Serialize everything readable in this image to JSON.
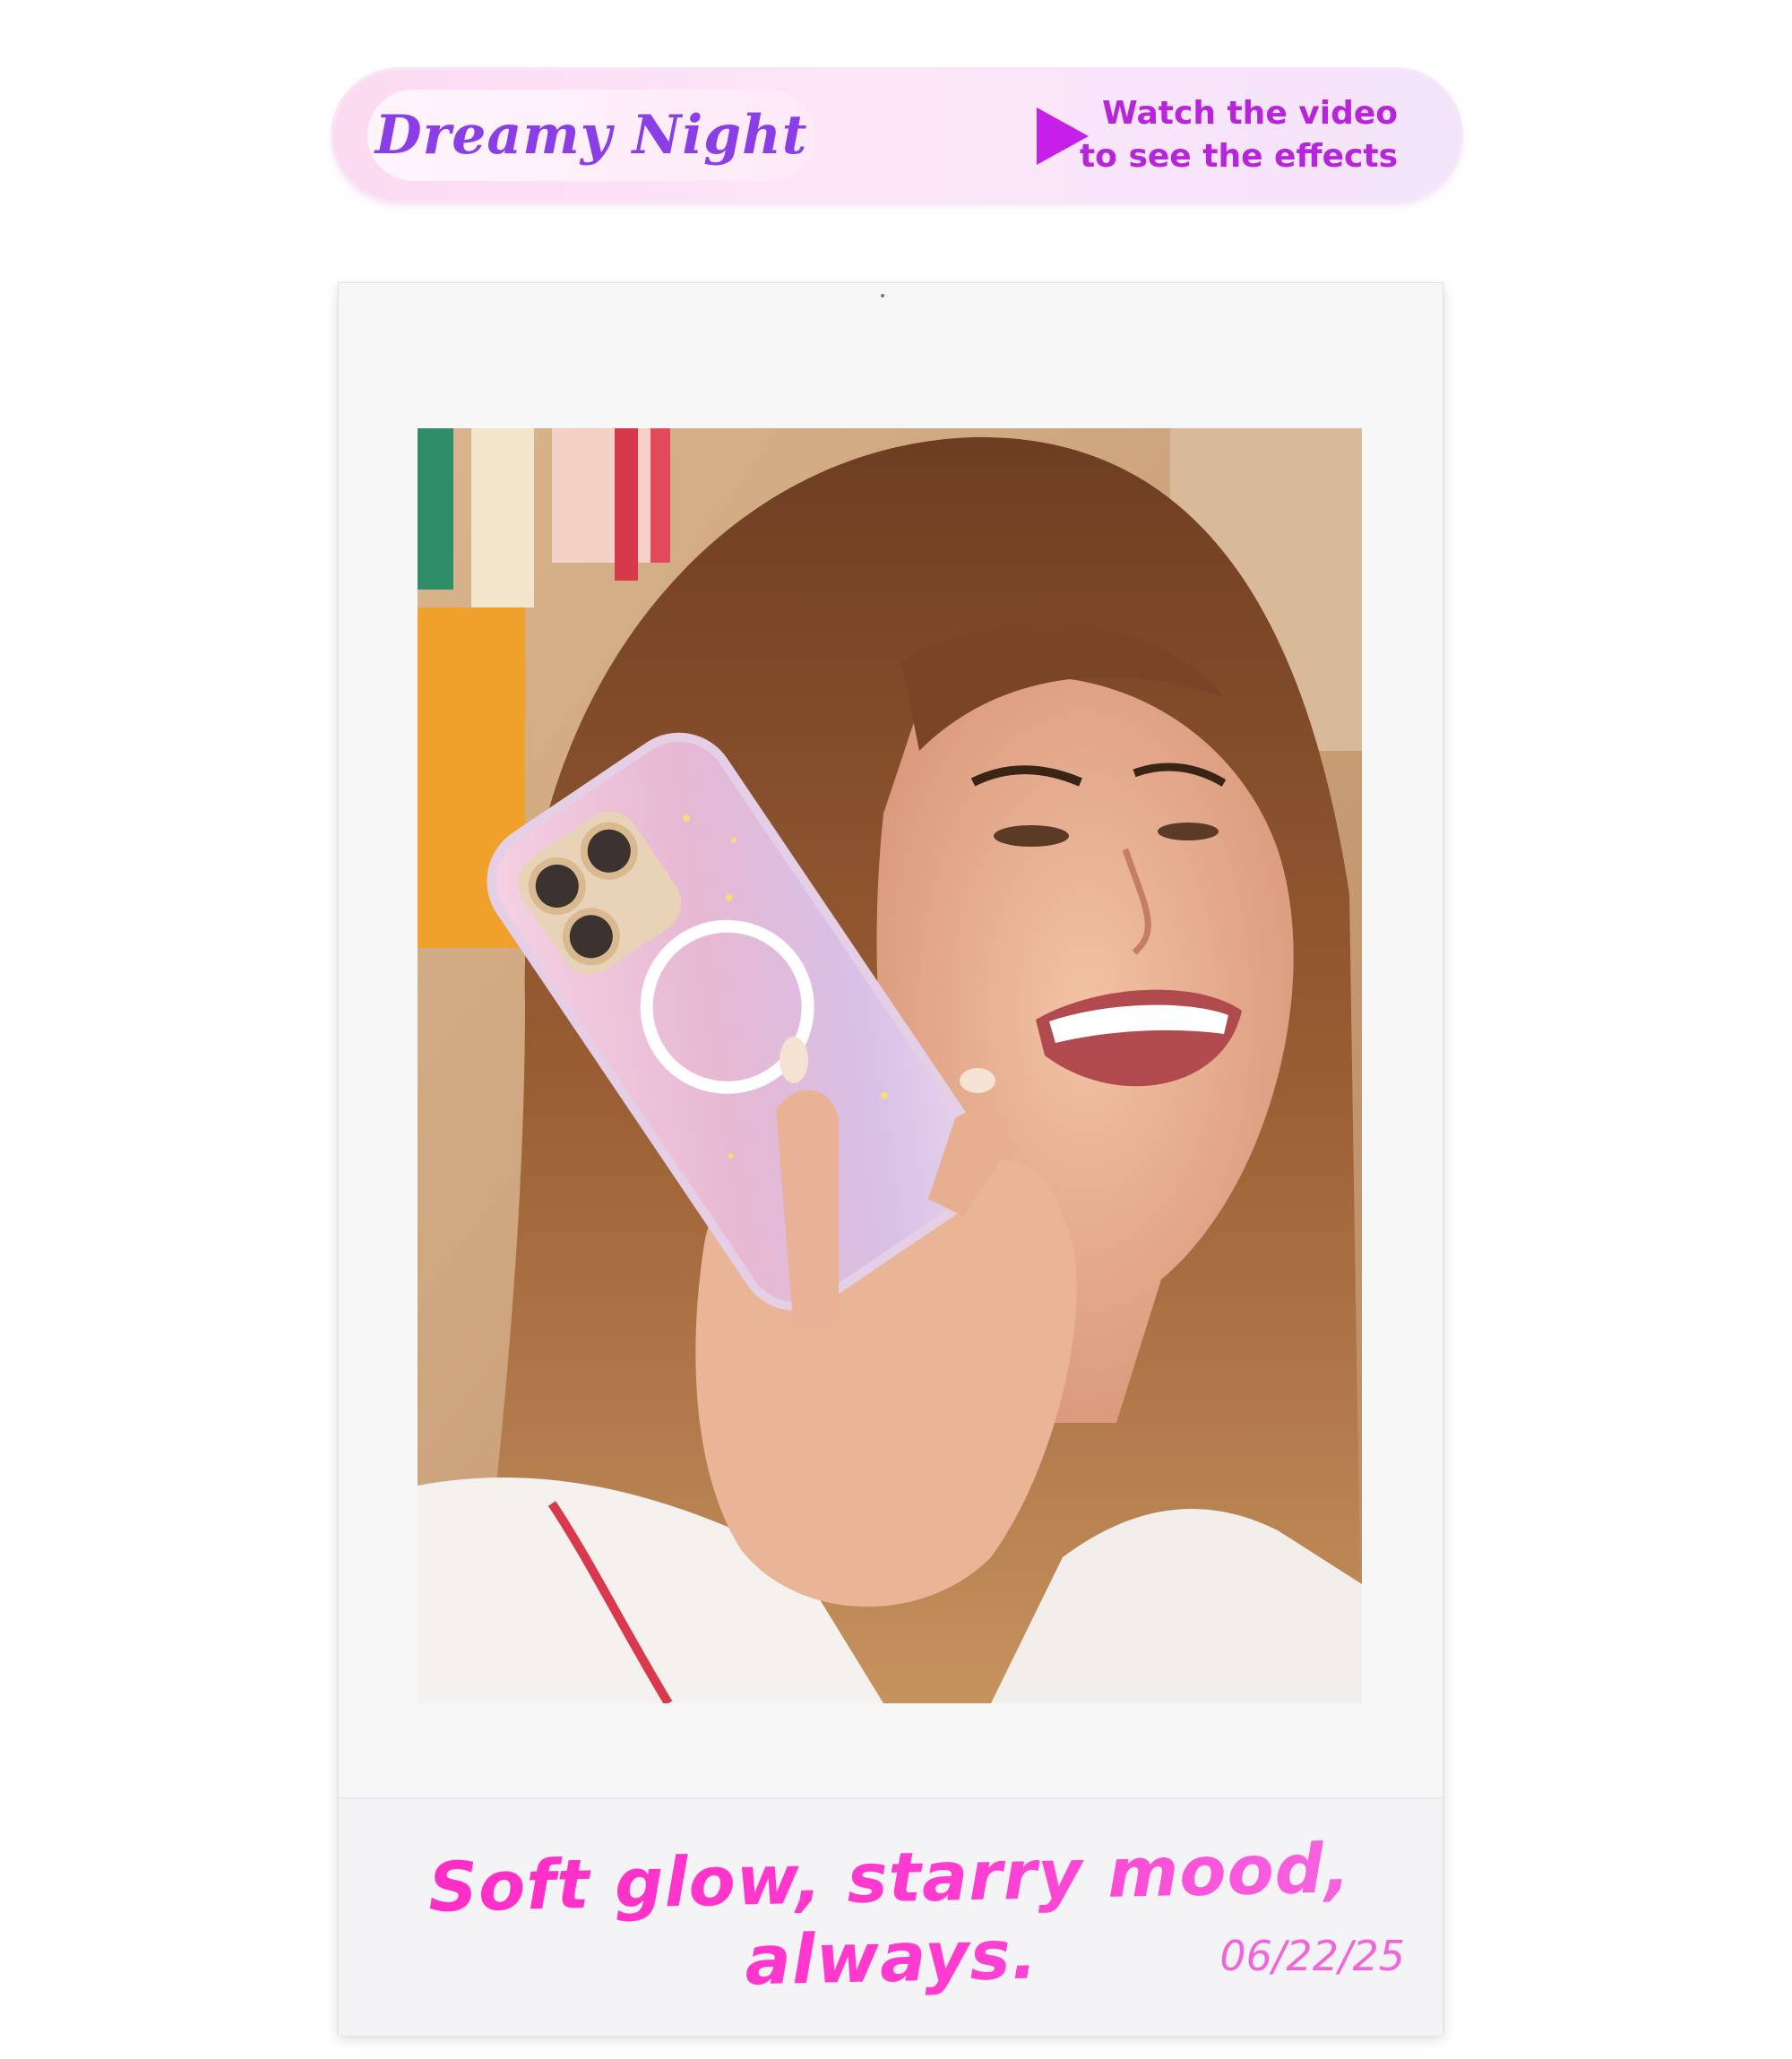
{
  "banner": {
    "title": "Dreamy Night",
    "cta_line1": "Watch the video",
    "cta_line2": "to see the effects",
    "play_icon": "play-icon",
    "colors": {
      "title": "#8a3fe6",
      "cta": "#b625d9",
      "play": "#c51fe8"
    }
  },
  "photo": {
    "icon": "photo-image"
  },
  "caption": {
    "text": "Soft glow, starry mood, always.",
    "date": "06/22/25",
    "colors": {
      "text": "#ff2bc4",
      "date": "#f066d8"
    }
  }
}
